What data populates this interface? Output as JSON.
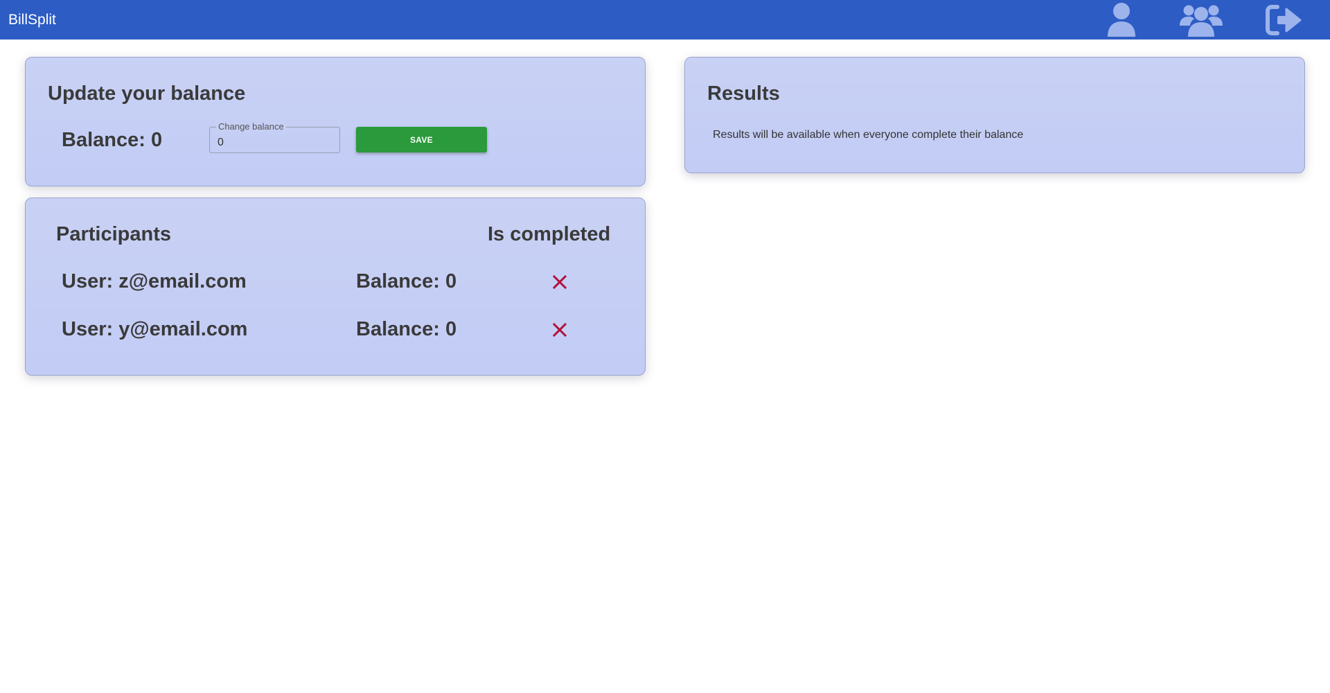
{
  "app": {
    "title": "BillSplit"
  },
  "nav": {
    "icons": [
      "profile-icon",
      "group-icon",
      "logout-icon"
    ],
    "icon_color": "#9db3ec",
    "bar_color": "#2d5cc4"
  },
  "update": {
    "title": "Update your balance",
    "balance_text": "Balance: 0",
    "field_label": "Change balance",
    "field_value": "0",
    "save_label": "SAVE"
  },
  "participants": {
    "title": "Participants",
    "status_header": "Is completed",
    "rows": [
      {
        "user": "User: z@email.com",
        "balance": "Balance: 0",
        "completed": false,
        "status_icon": "close-icon"
      },
      {
        "user": "User: y@email.com",
        "balance": "Balance: 0",
        "completed": false,
        "status_icon": "close-icon"
      }
    ],
    "status_color": "#b0103a"
  },
  "results": {
    "title": "Results",
    "message": "Results will be available when everyone complete their balance"
  }
}
